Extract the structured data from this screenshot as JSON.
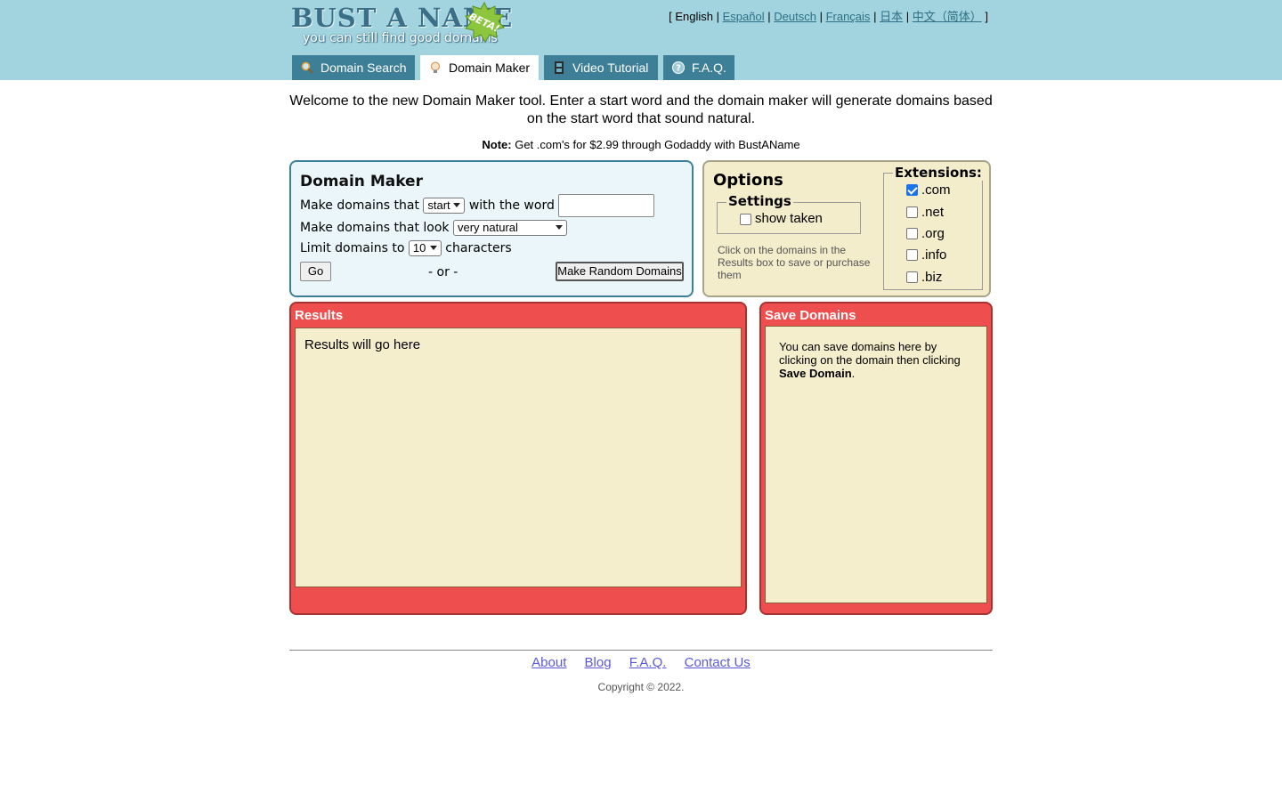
{
  "header": {
    "logo_title": "BUST A NAME",
    "logo_tagline": "you can still find good domains",
    "beta_badge": "BETA!",
    "languages": [
      {
        "label": "English",
        "active": true
      },
      {
        "label": "Español",
        "active": false
      },
      {
        "label": "Deutsch",
        "active": false
      },
      {
        "label": "Français",
        "active": false
      },
      {
        "label": "日本",
        "active": false
      },
      {
        "label": "中文（简体）",
        "active": false
      }
    ],
    "lang_open": "[",
    "lang_close": "]",
    "lang_sep": "|",
    "tabs": [
      {
        "label": "Domain Search",
        "icon": "magnifier-icon"
      },
      {
        "label": "Domain Maker",
        "icon": "lightbulb-icon",
        "active": true
      },
      {
        "label": "Video Tutorial",
        "icon": "film-icon"
      },
      {
        "label": "F.A.Q.",
        "icon": "help-icon"
      }
    ]
  },
  "intro": {
    "text": "Welcome to the new Domain Maker tool. Enter a start word and the domain maker will generate domains based on the start word that sound natural.",
    "note_label": "Note:",
    "note_text": "Get .com's for $2.99 through Godaddy with BustAName"
  },
  "maker": {
    "title": "Domain Maker",
    "row1_prefix": "Make domains that",
    "position_select": "start",
    "row1_mid": "with the word",
    "word_value": "",
    "row2_prefix": "Make domains that look",
    "look_select": "very natural",
    "row3_prefix": "Limit domains to",
    "limit_select": "10",
    "row3_suffix": "characters",
    "go_label": "Go",
    "or_label": "- or -",
    "random_label": "Make Random Domains"
  },
  "options": {
    "title": "Options",
    "settings_legend": "Settings",
    "show_taken_label": "show taken",
    "show_taken_checked": false,
    "help_text": "Click on the domains in the Results box to save or purchase them",
    "extensions_legend": "Extensions:",
    "extensions": [
      {
        "label": ".com",
        "checked": true
      },
      {
        "label": ".net",
        "checked": false
      },
      {
        "label": ".org",
        "checked": false
      },
      {
        "label": ".info",
        "checked": false
      },
      {
        "label": ".biz",
        "checked": false
      }
    ]
  },
  "results": {
    "title": "Results",
    "placeholder": "Results will go here"
  },
  "save": {
    "title": "Save Domains",
    "text": "You can save domains here by clicking on the domain then clicking",
    "emphasis": "Save Domain",
    "text_end": "."
  },
  "footer": {
    "links": [
      "About",
      "Blog",
      "F.A.Q.",
      "Contact Us"
    ],
    "copyright": "Copyright © 2022."
  },
  "colors": {
    "header_bg": "#a2d4e0",
    "tab_bg": "#3d7f96",
    "panel_red": "#ef4e4e",
    "panel_body": "#f4eecd",
    "options_bg": "#f3edcc",
    "maker_bg": "#eaf6f9"
  }
}
